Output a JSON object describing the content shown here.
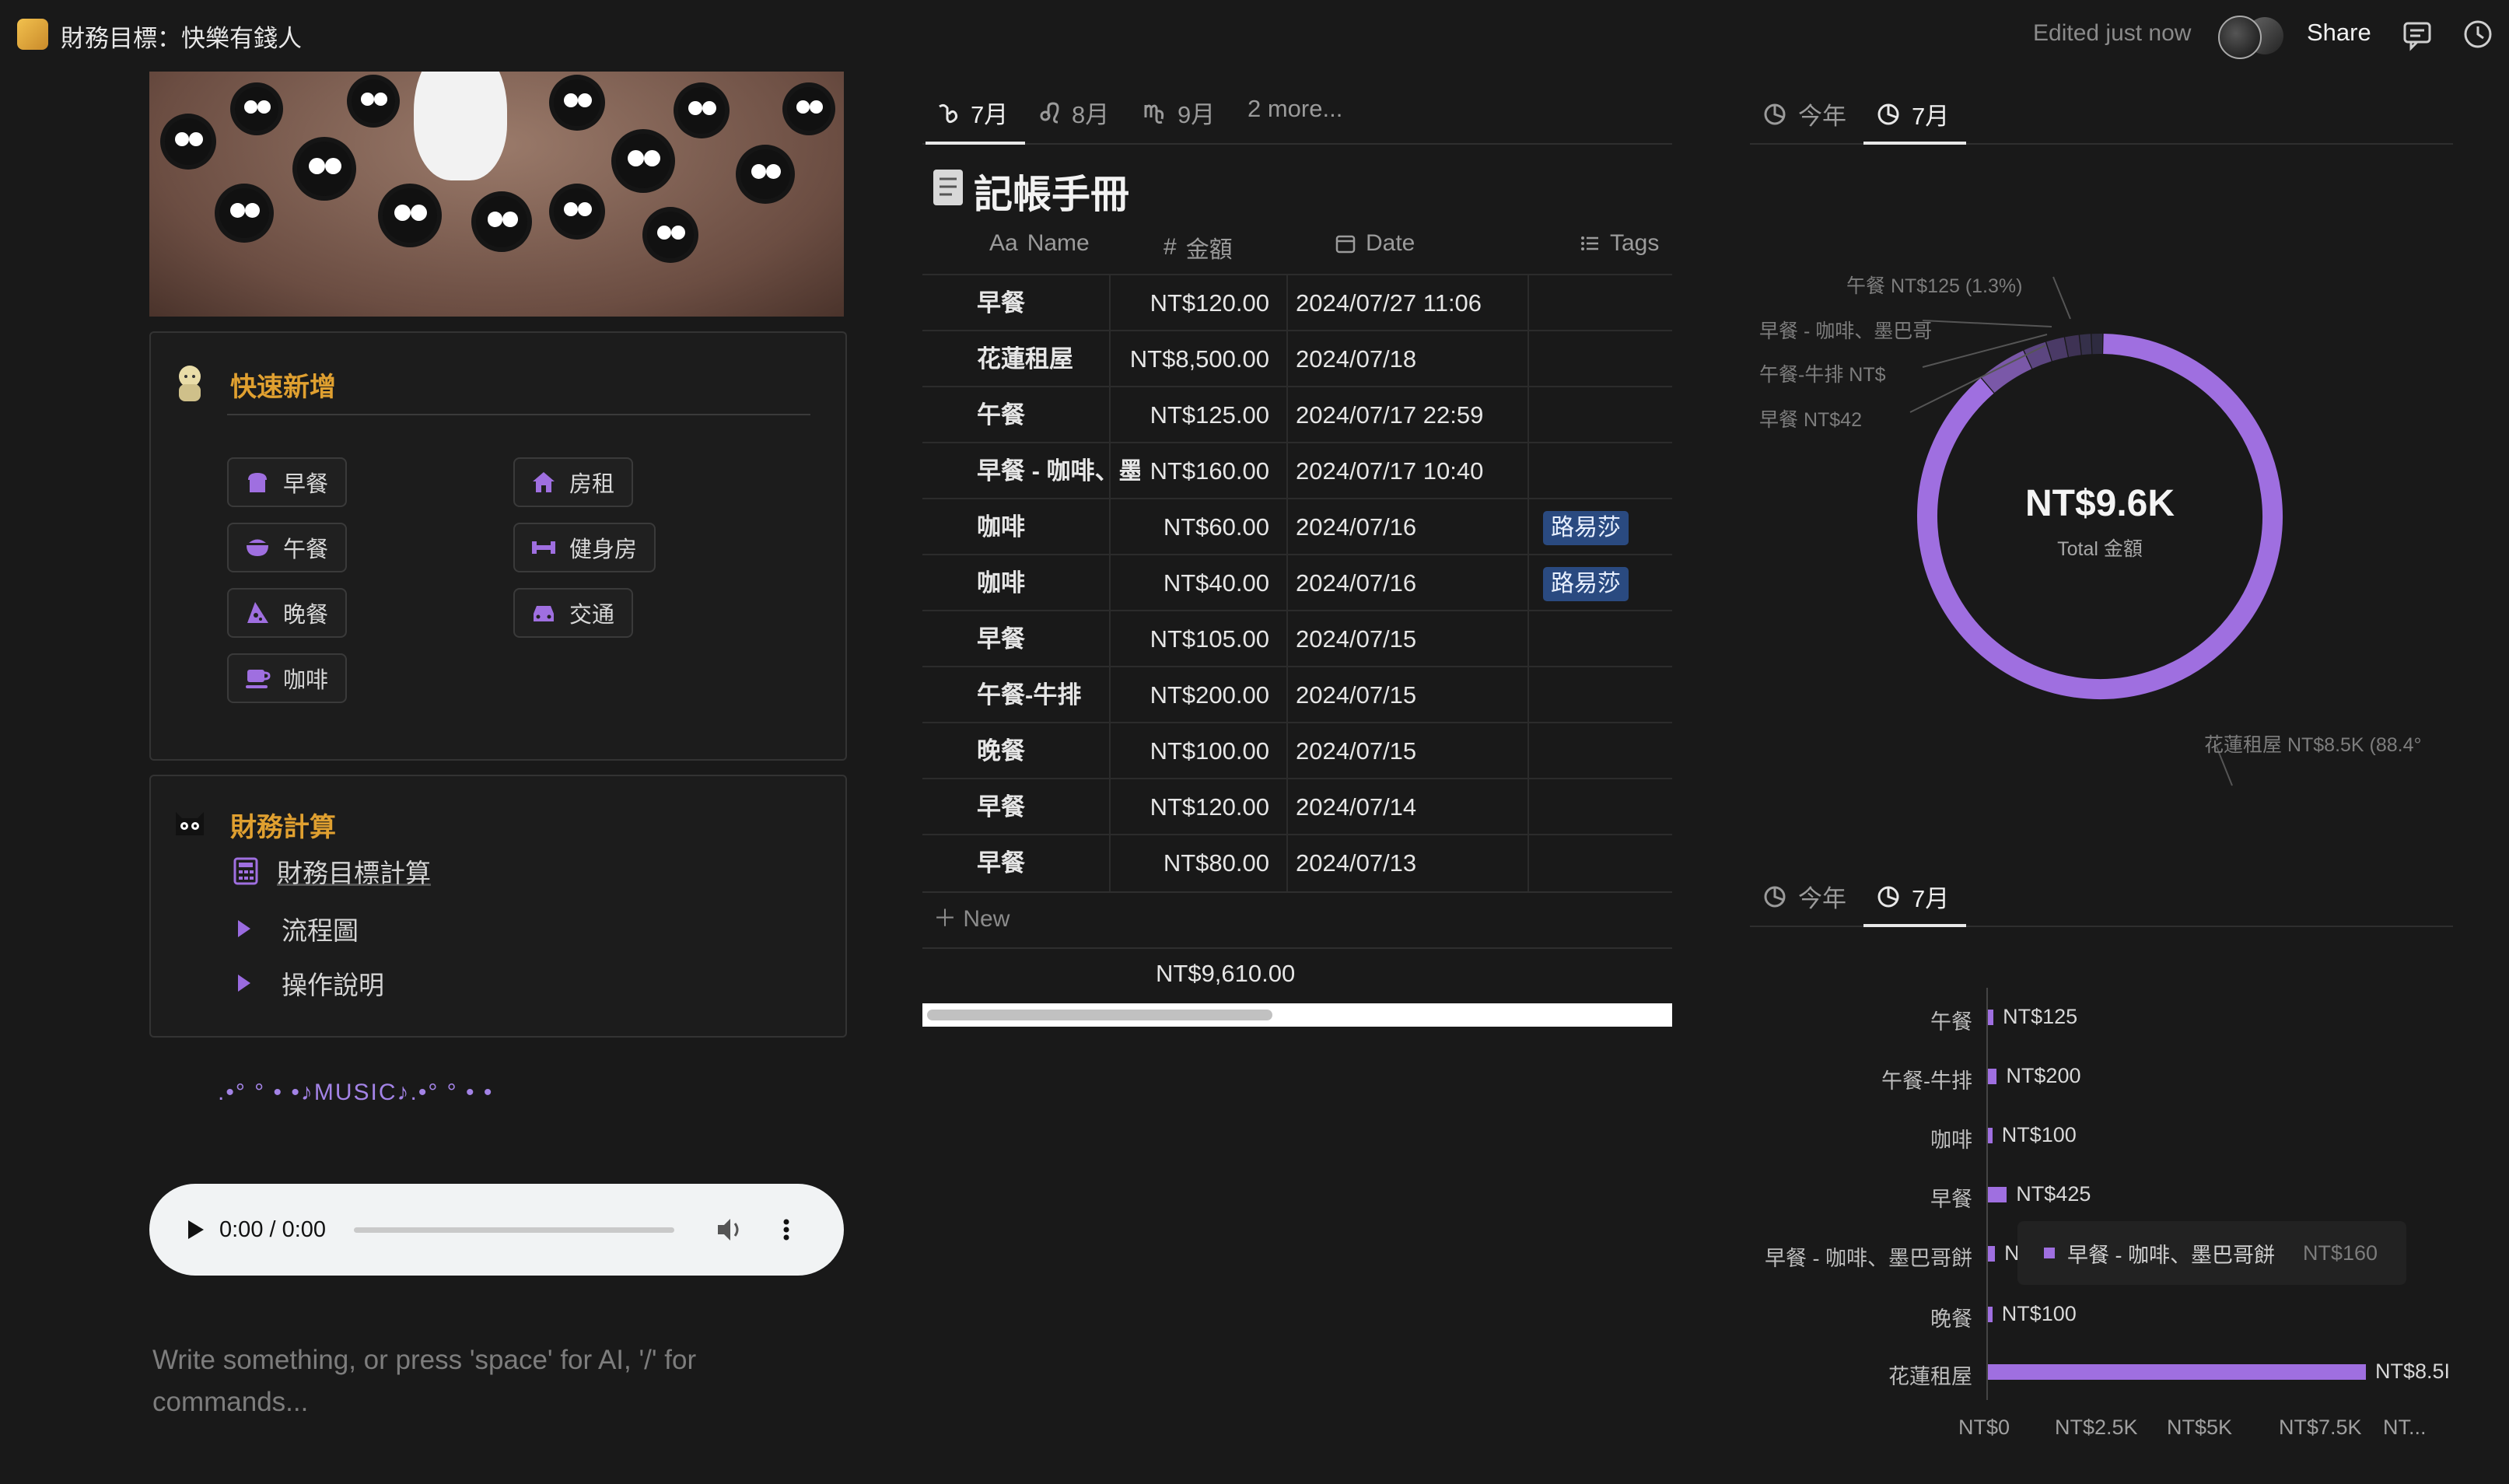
{
  "topbar": {
    "page_title": "財務目標：快樂有錢人",
    "edited": "Edited just now",
    "share": "Share",
    "icons": [
      "comment-icon",
      "history-icon"
    ]
  },
  "left": {
    "quick_add": {
      "title": "快速新增",
      "buttons": [
        {
          "label": "早餐",
          "icon": "bread-icon"
        },
        {
          "label": "房租",
          "icon": "house-icon"
        },
        {
          "label": "午餐",
          "icon": "bowl-icon"
        },
        {
          "label": "健身房",
          "icon": "dumbbell-icon"
        },
        {
          "label": "晚餐",
          "icon": "pizza-icon"
        },
        {
          "label": "交通",
          "icon": "car-icon"
        },
        {
          "label": "咖啡",
          "icon": "coffee-icon"
        }
      ]
    },
    "finance": {
      "title": "財務計算",
      "items": [
        "財務目標計算",
        "流程圖",
        "操作說明"
      ]
    },
    "music_text": ".•°  °   •  •♪MUSIC♪.•°  °   •  •",
    "audio": {
      "time": "0:00 / 0:00"
    },
    "placeholder": "Write something, or press 'space' for AI, '/' for commands..."
  },
  "middle": {
    "tabs": [
      {
        "label": "7月",
        "icon": "capricorn-icon",
        "active": true
      },
      {
        "label": "8月",
        "icon": "leo-icon",
        "active": false
      },
      {
        "label": "9月",
        "icon": "virgo-icon",
        "active": false
      },
      {
        "label": "2 more...",
        "icon": "",
        "active": false
      }
    ],
    "db_title": "記帳手冊",
    "columns": [
      {
        "prefix": "Aa",
        "label": "Name"
      },
      {
        "prefix": "#",
        "label": "金額"
      },
      {
        "prefix": "",
        "label": "Date"
      },
      {
        "prefix": "",
        "label": "Tags"
      }
    ],
    "rows": [
      {
        "name": "早餐",
        "amount": "NT$120.00",
        "date": "2024/07/27 11:06",
        "tag": ""
      },
      {
        "name": "花蓮租屋",
        "amount": "NT$8,500.00",
        "date": "2024/07/18",
        "tag": ""
      },
      {
        "name": "午餐",
        "amount": "NT$125.00",
        "date": "2024/07/17 22:59",
        "tag": ""
      },
      {
        "name": "早餐 - 咖啡、墨巴哥餅",
        "amount": "NT$160.00",
        "date": "2024/07/17 10:40",
        "tag": ""
      },
      {
        "name": "咖啡",
        "amount": "NT$60.00",
        "date": "2024/07/16",
        "tag": "路易莎"
      },
      {
        "name": "咖啡",
        "amount": "NT$40.00",
        "date": "2024/07/16",
        "tag": "路易莎"
      },
      {
        "name": "早餐",
        "amount": "NT$105.00",
        "date": "2024/07/15",
        "tag": ""
      },
      {
        "name": "午餐-牛排",
        "amount": "NT$200.00",
        "date": "2024/07/15",
        "tag": ""
      },
      {
        "name": "晚餐",
        "amount": "NT$100.00",
        "date": "2024/07/15",
        "tag": ""
      },
      {
        "name": "早餐",
        "amount": "NT$120.00",
        "date": "2024/07/14",
        "tag": ""
      },
      {
        "name": "早餐",
        "amount": "NT$80.00",
        "date": "2024/07/13",
        "tag": ""
      }
    ],
    "new_label": "New",
    "sum": "NT$9,610.00"
  },
  "right": {
    "tabs_top": [
      {
        "label": "今年",
        "active": false
      },
      {
        "label": "7月",
        "active": true
      }
    ],
    "tabs_bottom": [
      {
        "label": "今年",
        "active": false
      },
      {
        "label": "7月",
        "active": true
      }
    ],
    "donut": {
      "total": "NT$9.6K",
      "subtitle": "Total 金額",
      "labels": [
        "午餐  NT$125 (1.3%)",
        "早餐 - 咖啡、墨巴哥",
        "午餐-牛排  NT$",
        "早餐  NT$42",
        "花蓮租屋  NT$8.5K (88.4°"
      ]
    },
    "tooltip": {
      "label": "早餐 - 咖啡、墨巴哥餅",
      "value": "NT$160"
    }
  },
  "chart_data": [
    {
      "type": "pie",
      "title": "",
      "total_label": "NT$9.6K",
      "slices": [
        {
          "name": "花蓮租屋",
          "value": 8500
        },
        {
          "name": "早餐",
          "value": 425
        },
        {
          "name": "午餐-牛排",
          "value": 200
        },
        {
          "name": "早餐 - 咖啡、墨巴哥餅",
          "value": 160
        },
        {
          "name": "午餐",
          "value": 125
        },
        {
          "name": "咖啡",
          "value": 100
        },
        {
          "name": "晚餐",
          "value": 100
        }
      ],
      "colors": [
        "#9f6fe0",
        "#7a58a8",
        "#5c4680",
        "#4a3a66",
        "#3e3254",
        "#35304a",
        "#2e2b40"
      ]
    },
    {
      "type": "bar",
      "orientation": "horizontal",
      "categories": [
        "午餐",
        "午餐-牛排",
        "咖啡",
        "早餐",
        "早餐 - 咖啡、墨巴哥餅",
        "晚餐",
        "花蓮租屋"
      ],
      "values": [
        125,
        200,
        100,
        425,
        160,
        100,
        8500
      ],
      "value_labels": [
        "NT$125",
        "NT$200",
        "NT$100",
        "NT$425",
        "NT",
        "NT$100",
        "NT$8.5I"
      ],
      "xticks": [
        "NT$0",
        "NT$2.5K",
        "NT$5K",
        "NT$7.5K",
        "NT..."
      ],
      "xlim": [
        0,
        10000
      ],
      "color": "#9f6fe0"
    }
  ]
}
